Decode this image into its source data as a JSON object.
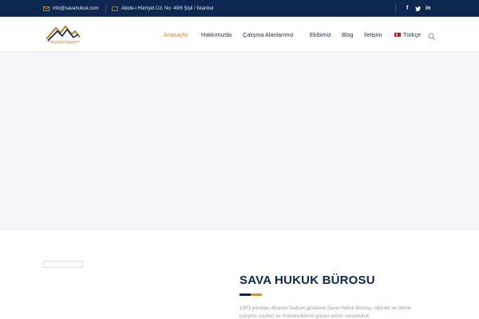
{
  "topbar": {
    "email": "info@savahukuk.com",
    "address": "Abide-i Hürriyet Cd. No: 49/6 Şişli / İstanbul",
    "social": {
      "facebook": "f",
      "twitter": "t",
      "linkedin": "in"
    },
    "icons": {
      "email": "envelope-icon",
      "address": "map-icon",
      "facebook": "facebook-icon",
      "twitter": "twitter-icon",
      "linkedin": "linkedin-icon"
    }
  },
  "header": {
    "logo_caption": "SAVA HUKUK BÜROSU",
    "nav": [
      {
        "label": "Anasayfa",
        "active": true
      },
      {
        "label": "Hakkımızda",
        "active": false
      },
      {
        "label": "Çalışma Alanlarımız",
        "active": false
      },
      {
        "label": "Ekibimiz",
        "active": false
      },
      {
        "label": "Blog",
        "active": false
      },
      {
        "label": "İletişim",
        "active": false
      }
    ],
    "language": "Türkçe",
    "search_icon": "search-icon"
  },
  "about": {
    "title": "SAVA HUKUK BÜROSU",
    "text": "1993 yılından itibaren faaliyet gösteren Sava Hukuk Bürosu, dikkatli ve özenli çalışma usulleri ve müvekkillerine güven veren sorumluluk"
  },
  "colors": {
    "navy": "#0d2750",
    "gold": "#c08a3e",
    "hero_bg": "#f5f6fa"
  }
}
